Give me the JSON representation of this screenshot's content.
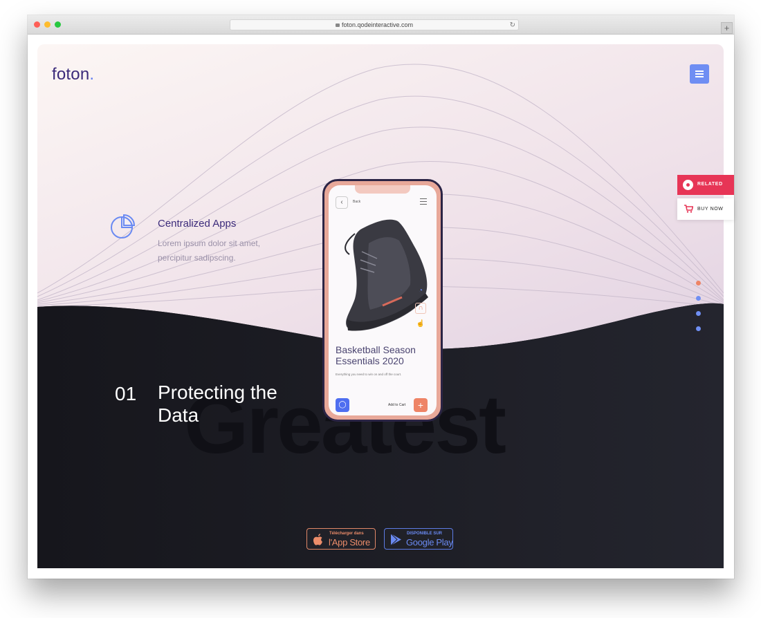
{
  "browser": {
    "url": "foton.qodeinteractive.com",
    "new_tab_label": "+"
  },
  "site": {
    "logo_text": "foton",
    "logo_dot": ".",
    "feature": {
      "icon": "pie-chart-icon",
      "title": "Centralized Apps",
      "text": "Lorem ipsum dolor sit amet, percipitur sadipscing."
    },
    "section": {
      "number": "01",
      "heading": "Protecting the Data",
      "background_word": "Greatest"
    },
    "phone": {
      "back_label": "Back",
      "product_title": "Basketball Season Essentials 2020",
      "product_sub": "Everything you need to win on and off the court.",
      "cart_label": "Add to Cart",
      "plus_label": "+",
      "icons": [
        "chevron-left-icon",
        "menu-icon",
        "pie-chart-icon",
        "headphones-icon",
        "thumbs-up-icon",
        "chat-icon"
      ]
    },
    "badges": {
      "apple_small": "Télécharger dans",
      "apple_big": "l'App Store",
      "google_small": "DISPONIBLE SUR",
      "google_big": "Google Play"
    }
  },
  "widgets": {
    "related_label": "RELATED",
    "buy_now_label": "BUY NOW"
  },
  "colors": {
    "brand_purple": "#3b2a7a",
    "accent_blue": "#6f8ef3",
    "accent_coral": "#ee8466",
    "related_red": "#e73556",
    "dark_bg": "#1b1b22"
  }
}
